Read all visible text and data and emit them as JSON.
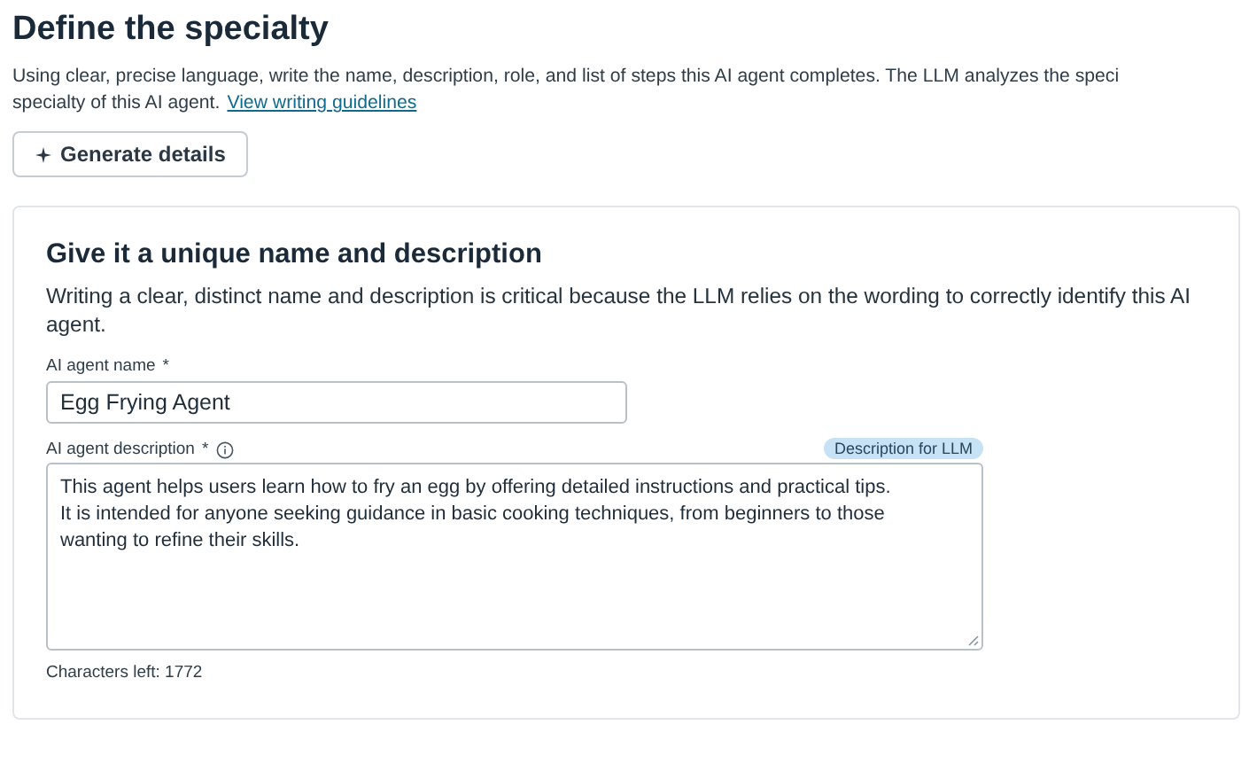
{
  "heading": "Define the specialty",
  "intro_lines": [
    "Using clear, precise language, write the name, description, role, and list of steps this AI agent completes. The LLM analyzes the speci",
    "specialty of this AI agent."
  ],
  "intro_link": "View writing guidelines",
  "generate_button": {
    "label": "Generate details"
  },
  "card": {
    "title": "Give it a unique name and description",
    "text": "Writing a clear, distinct name and description is critical because the LLM relies on the wording to correctly identify this AI agent.",
    "name_field": {
      "label": "AI agent name",
      "required_mark": "*",
      "value": "Egg Frying Agent"
    },
    "description_field": {
      "label": "AI agent description",
      "required_mark": "*",
      "badge": "Description for LLM",
      "value_lines": [
        "This agent helps users learn how to fry an egg by offering detailed instructions and practical tips.",
        "It is intended for anyone seeking guidance in basic cooking techniques, from beginners to those",
        "wanting to refine their skills."
      ]
    },
    "characters_left": "Characters left: 1772"
  }
}
